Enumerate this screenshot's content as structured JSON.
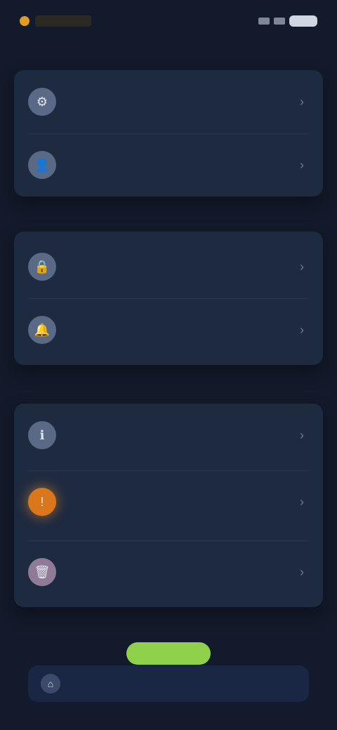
{
  "status_bar": {
    "time": "",
    "icons": [
      "signal-icon",
      "wifi-icon",
      "battery-icon"
    ]
  },
  "page": {
    "title": ""
  },
  "section_1": {
    "rows": [
      {
        "title": "",
        "subtitle": "",
        "icon": "settings-icon"
      },
      {
        "title": "",
        "subtitle": "",
        "icon": "user-icon"
      }
    ]
  },
  "section_2": {
    "title": "",
    "rows": [
      {
        "title": "",
        "subtitle": "",
        "icon": "lock-icon"
      },
      {
        "title": "",
        "subtitle": "",
        "icon": "bell-icon"
      }
    ]
  },
  "section_3": {
    "title": "",
    "rows": [
      {
        "title": "",
        "subtitle": "",
        "icon": "info-icon"
      },
      {
        "title": "",
        "subtitle": "",
        "icon": "warning-icon"
      },
      {
        "title": "",
        "subtitle": "",
        "icon": "trash-icon"
      }
    ]
  },
  "primary_action": {
    "label": ""
  },
  "bottom_bar": {
    "label": ""
  },
  "colors": {
    "background": "#121a2b",
    "card": "#1e2a40",
    "accent_green": "#8fd14a",
    "danger": "#b13a3a",
    "warning": "#d9771a"
  }
}
